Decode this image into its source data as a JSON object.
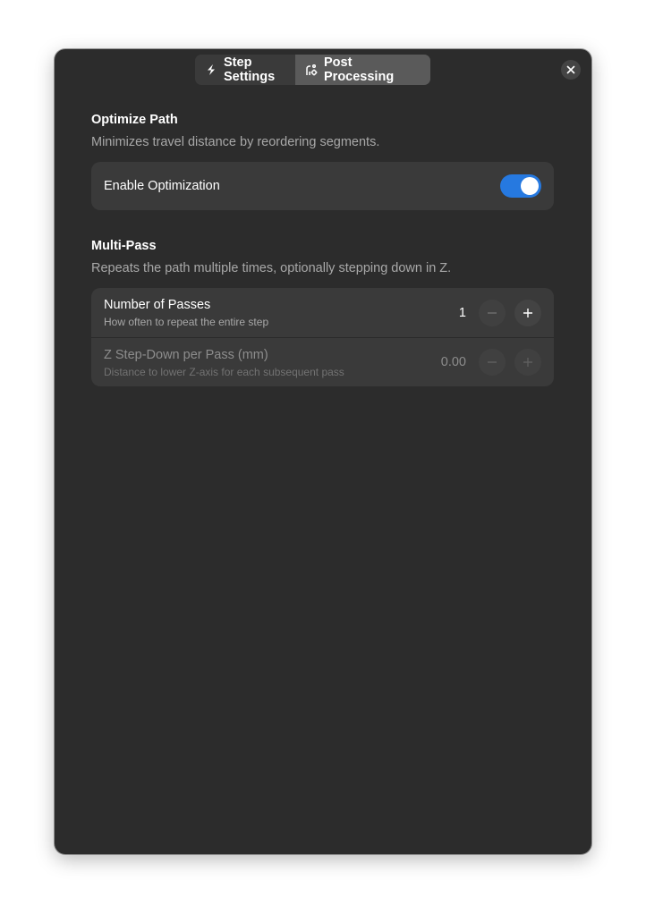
{
  "tabs": {
    "step_settings": "Step Settings",
    "post_processing": "Post Processing",
    "active": "post_processing"
  },
  "optimize": {
    "title": "Optimize Path",
    "description": "Minimizes travel distance by reordering segments.",
    "enable_label": "Enable Optimization",
    "enabled": true
  },
  "multipass": {
    "title": "Multi-Pass",
    "description": "Repeats the path multiple times, optionally stepping down in Z.",
    "passes": {
      "label": "Number of Passes",
      "sublabel": "How often to repeat the entire step",
      "value": "1"
    },
    "stepdown": {
      "label": "Z Step-Down per Pass (mm)",
      "sublabel": "Distance to lower Z-axis for each subsequent pass",
      "value": "0.00"
    }
  },
  "colors": {
    "accent": "#2679e0",
    "window_bg": "#2c2c2c",
    "card_bg": "#3a3a3a"
  },
  "icons": {
    "step_settings": "lightning-icon",
    "post_processing": "path-gear-icon",
    "close": "close-icon",
    "minus": "minus-icon",
    "plus": "plus-icon"
  }
}
